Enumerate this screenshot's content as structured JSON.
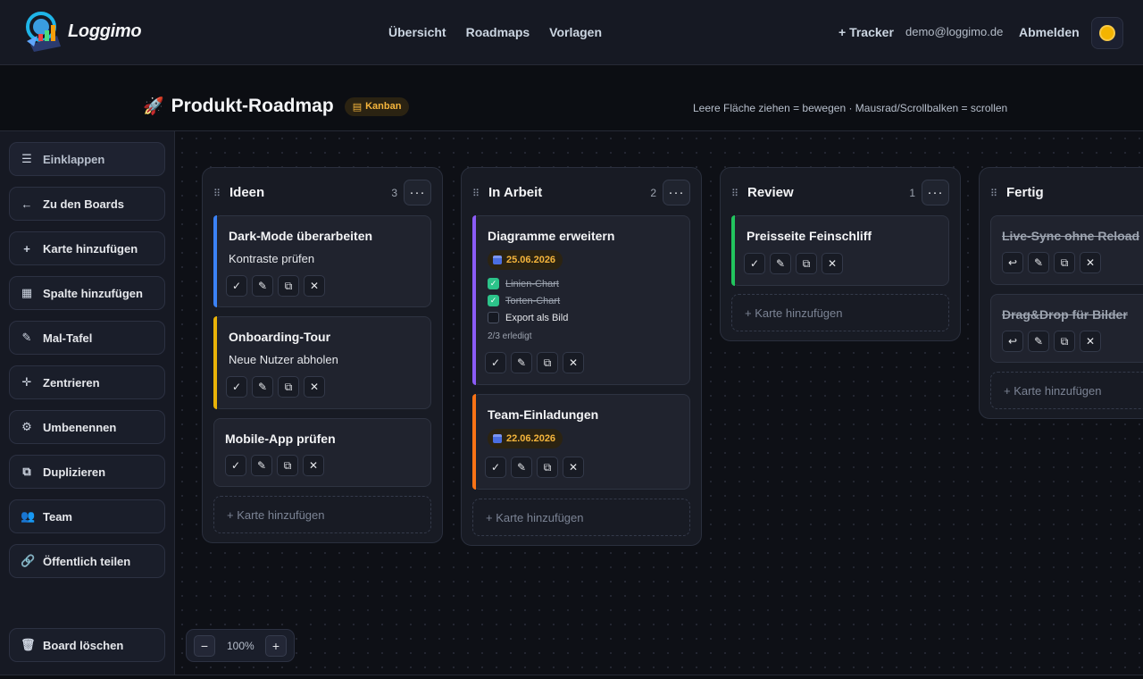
{
  "nav": {
    "brand": "Loggimo",
    "links": [
      "Übersicht",
      "Roadmaps",
      "Vorlagen"
    ],
    "tracker": "+ Tracker",
    "email": "demo@loggimo.de",
    "logout": "Abmelden"
  },
  "board": {
    "title": "Produkt-Roadmap",
    "badge": "Kanban",
    "hint": "Leere Fläche ziehen = bewegen · Mausrad/Scrollbalken = scrollen"
  },
  "sidebar": {
    "collapse": "Einklappen",
    "back": "Zu den Boards",
    "add_card": "Karte hinzufügen",
    "add_column": "Spalte hinzufügen",
    "paint": "Mal-Tafel",
    "center": "Zentrieren",
    "rename": "Umbenennen",
    "duplicate": "Duplizieren",
    "team": "Team",
    "share": "Öffentlich teilen",
    "delete": "Board löschen"
  },
  "colors": {
    "accent_blue": "#3b82f6",
    "accent_yellow": "#eab308",
    "accent_purple": "#8b5cf6",
    "accent_orange": "#f97316",
    "accent_green": "#22c55e",
    "date_text": "#f5b53c"
  },
  "columns": [
    {
      "title": "Ideen",
      "count": "3",
      "menu": "···",
      "cards": [
        {
          "title": "Dark-Mode überarbeiten",
          "desc": "Kontraste prüfen"
        },
        {
          "title": "Onboarding-Tour",
          "desc": "Neue Nutzer abholen"
        },
        {
          "title": "Mobile-App prüfen"
        }
      ],
      "add": "+ Karte hinzufügen"
    },
    {
      "title": "In Arbeit",
      "count": "2",
      "menu": "···",
      "cards": [
        {
          "title": "Diagramme erweitern",
          "date": "25.06.2026",
          "checklist": [
            {
              "text": "Linien-Chart",
              "done": true
            },
            {
              "text": "Torten-Chart",
              "done": true
            },
            {
              "text": "Export als Bild",
              "done": false
            }
          ],
          "progress": "2/3 erledigt"
        },
        {
          "title": "Team-Einladungen",
          "date": "22.06.2026"
        }
      ],
      "add": "+ Karte hinzufügen"
    },
    {
      "title": "Review",
      "count": "1",
      "menu": "···",
      "cards": [
        {
          "title": "Preisseite Feinschliff"
        }
      ],
      "add": "+ Karte hinzufügen"
    },
    {
      "title": "Fertig",
      "cards": [
        {
          "title": "Live-Sync ohne Reload"
        },
        {
          "title": "Drag&Drop für Bilder"
        }
      ],
      "add": "+ Karte hinzufügen"
    }
  ],
  "zoom": {
    "minus": "−",
    "level": "100%",
    "plus": "+"
  }
}
